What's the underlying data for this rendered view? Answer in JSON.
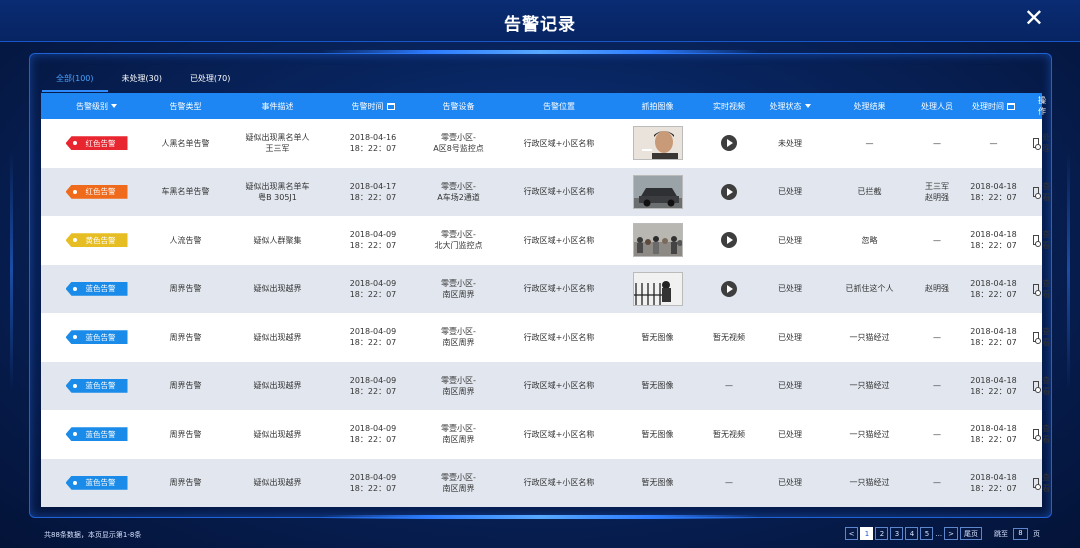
{
  "header": {
    "title": "告警记录",
    "close_label": "✕"
  },
  "tabs": [
    {
      "label": "全部(100)",
      "active": true
    },
    {
      "label": "未处理(30)",
      "active": false
    },
    {
      "label": "已处理(70)",
      "active": false
    }
  ],
  "table": {
    "columns": [
      "告警级别",
      "告警类型",
      "事件描述",
      "告警时间",
      "告警设备",
      "告警位置",
      "抓拍图像",
      "实时视频",
      "处理状态",
      "处理结果",
      "处理人员",
      "处理时间",
      "操作"
    ],
    "rows": [
      {
        "level": "红色告警",
        "level_color": "#e8262f",
        "type": "人黑名单告警",
        "desc": "疑似出现黑名单人\n王三军",
        "time": "2018-04-16\n18：22：07",
        "device": "零壹小区-\nA区8号监控点",
        "location": "行政区域+小区名称",
        "image": "face",
        "video": "play",
        "status": "未处理",
        "result": "—",
        "handler": "—",
        "handle_time": "—",
        "action": "处理"
      },
      {
        "level": "红色告警",
        "level_color": "#f06a1c",
        "type": "车黑名单告警",
        "desc": "疑似出现黑名单车\n粤B 305J1",
        "time": "2018-04-17\n18：22：07",
        "device": "零壹小区-\nA车场2通道",
        "location": "行政区域+小区名称",
        "image": "car",
        "video": "play",
        "status": "已处理",
        "result": "已拦截",
        "handler": "王三军\n赵明强",
        "handle_time": "2018-04-18\n18：22：07",
        "action": "查看"
      },
      {
        "level": "黄色告警",
        "level_color": "#e6bd22",
        "type": "人流告警",
        "desc": "疑似人群聚集",
        "time": "2018-04-09\n18：22：07",
        "device": "零壹小区-\n北大门监控点",
        "location": "行政区域+小区名称",
        "image": "crowd",
        "video": "play",
        "status": "已处理",
        "result": "忽略",
        "handler": "—",
        "handle_time": "2018-04-18\n18：22：07",
        "action": "查看"
      },
      {
        "level": "蓝色告警",
        "level_color": "#1a8be8",
        "type": "周界告警",
        "desc": "疑似出现越界",
        "time": "2018-04-09\n18：22：07",
        "device": "零壹小区-\n南区周界",
        "location": "行政区域+小区名称",
        "image": "fence",
        "video": "play",
        "status": "已处理",
        "result": "已抓住这个人",
        "handler": "赵明强",
        "handle_time": "2018-04-18\n18：22：07",
        "action": "查看"
      },
      {
        "level": "蓝色告警",
        "level_color": "#1a8be8",
        "type": "周界告警",
        "desc": "疑似出现越界",
        "time": "2018-04-09\n18：22：07",
        "device": "零壹小区-\n南区周界",
        "location": "行政区域+小区名称",
        "image_text": "暂无图像",
        "video_text": "暂无视频",
        "status": "已处理",
        "result": "一只猫经过",
        "handler": "—",
        "handle_time": "2018-04-18\n18：22：07",
        "action": "查看"
      },
      {
        "level": "蓝色告警",
        "level_color": "#1a8be8",
        "type": "周界告警",
        "desc": "疑似出现越界",
        "time": "2018-04-09\n18：22：07",
        "device": "零壹小区-\n南区周界",
        "location": "行政区域+小区名称",
        "image_text": "暂无图像",
        "video_text": "—",
        "status": "已处理",
        "result": "一只猫经过",
        "handler": "—",
        "handle_time": "2018-04-18\n18：22：07",
        "action": "查看"
      },
      {
        "level": "蓝色告警",
        "level_color": "#1a8be8",
        "type": "周界告警",
        "desc": "疑似出现越界",
        "time": "2018-04-09\n18：22：07",
        "device": "零壹小区-\n南区周界",
        "location": "行政区域+小区名称",
        "image_text": "暂无图像",
        "video_text": "暂无视频",
        "status": "已处理",
        "result": "一只猫经过",
        "handler": "—",
        "handle_time": "2018-04-18\n18：22：07",
        "action": "查看"
      },
      {
        "level": "蓝色告警",
        "level_color": "#1a8be8",
        "type": "周界告警",
        "desc": "疑似出现越界",
        "time": "2018-04-09\n18：22：07",
        "device": "零壹小区-\n南区周界",
        "location": "行政区域+小区名称",
        "image_text": "暂无图像",
        "video_text": "—",
        "status": "已处理",
        "result": "一只猫经过",
        "handler": "—",
        "handle_time": "2018-04-18\n18：22：07",
        "action": "查看"
      }
    ]
  },
  "footer": {
    "info": "共88条数据，本页显示第1-8条",
    "prev": "<",
    "pages": [
      "1",
      "2",
      "3",
      "4",
      "5"
    ],
    "ellipsis": "...",
    "next": ">",
    "last": "尾页",
    "jump_label": "跳至",
    "jump_value": "8",
    "page_unit": "页"
  }
}
